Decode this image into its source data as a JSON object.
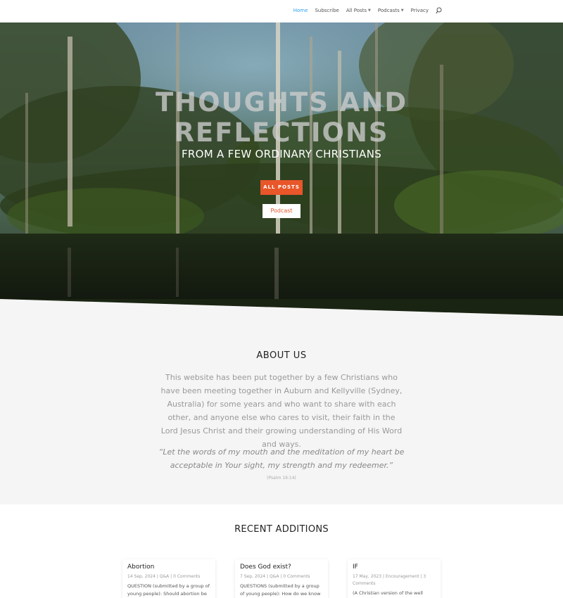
{
  "nav": {
    "items": [
      {
        "label": "Home",
        "active": true,
        "has_dropdown": false
      },
      {
        "label": "Subscribe",
        "active": false,
        "has_dropdown": false
      },
      {
        "label": "All Posts",
        "active": false,
        "has_dropdown": true
      },
      {
        "label": "Podcasts",
        "active": false,
        "has_dropdown": true
      },
      {
        "label": "Privacy",
        "active": false,
        "has_dropdown": false
      }
    ],
    "search_icon": "search-icon",
    "active_color": "#2ea3f2"
  },
  "hero": {
    "title_line1": "THOUGHTS AND",
    "title_line2": "REFLECTIONS",
    "subtitle": "FROM A FEW ORDINARY CHRISTIANS",
    "primary_button": "ALL POSTS",
    "secondary_button": "Podcast",
    "accent_color": "#e8562a"
  },
  "about": {
    "title": "ABOUT US",
    "text": "This website has been put together by a few Christians who have been meeting together in Auburn and Kellyville (Sydney, Australia) for some years and who want to share with each other, and anyone else who cares to visit, their faith in the Lord Jesus Christ and their growing understanding of His Word and ways.",
    "quote": "“Let the words of my mouth and the meditation of my heart be acceptable in Your sight, my strength and my redeemer.”",
    "quote_ref": "(Psalm 19:14)"
  },
  "recent": {
    "title": "RECENT ADDITIONS",
    "posts": [
      {
        "title": "Abortion",
        "meta": "14 Sep, 2024 | Q&A | 0 Comments",
        "excerpt": "QUESTION (submitted by a group of young people): Should abortion be"
      },
      {
        "title": "Does God exist?",
        "meta": "7 Sep, 2024 | Q&A | 0 Comments",
        "excerpt": "QUESTIONS (submitted by a group of young people): How do we know that"
      },
      {
        "title": "IF",
        "meta": "17 May, 2023 | Encouragement | 3 Comments",
        "excerpt": "(A Christian version of the well known"
      }
    ]
  }
}
